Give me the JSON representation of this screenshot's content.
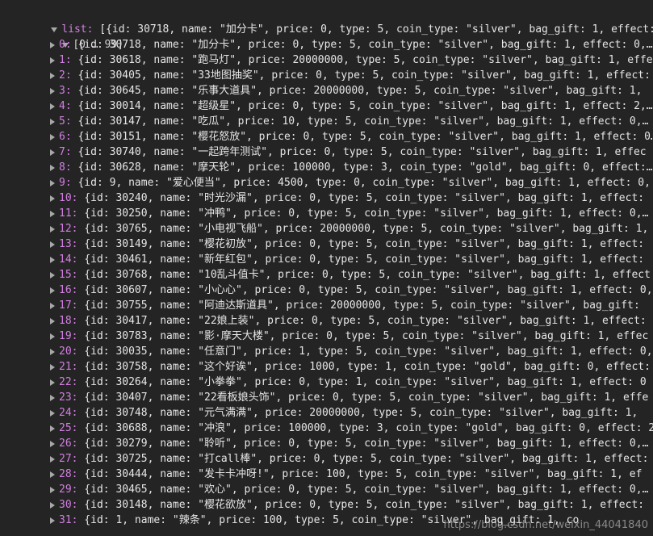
{
  "console": {
    "list_key": "list:",
    "list_preview": "[{id: 30718, name: \"加分卡\", price: 0, type: 5, coin_type: \"silver\", bag_gift: 1, effect: 0,…",
    "range_label": "[0 … 99]",
    "rows": [
      {
        "index": "0:",
        "text": "{id: 30718, name: \"加分卡\", price: 0, type: 5, coin_type: \"silver\", bag_gift: 1, effect: 0,…"
      },
      {
        "index": "1:",
        "text": "{id: 30618, name: \"跑马灯\", price: 20000000, type: 5, coin_type: \"silver\", bag_gift: 1, effe"
      },
      {
        "index": "2:",
        "text": "{id: 30405, name: \"33地图抽奖\", price: 0, type: 5, coin_type: \"silver\", bag_gift: 1, effect:"
      },
      {
        "index": "3:",
        "text": "{id: 30645, name: \"乐事大道具\", price: 20000000, type: 5, coin_type: \"silver\", bag_gift: 1,"
      },
      {
        "index": "4:",
        "text": "{id: 30014, name: \"超级星\", price: 0, type: 5, coin_type: \"silver\", bag_gift: 1, effect: 2,…"
      },
      {
        "index": "5:",
        "text": "{id: 30147, name: \"吃瓜\", price: 10, type: 5, coin_type: \"silver\", bag_gift: 1, effect: 0,…"
      },
      {
        "index": "6:",
        "text": "{id: 30151, name: \"樱花怒放\", price: 0, type: 5, coin_type: \"silver\", bag_gift: 1, effect: 0…"
      },
      {
        "index": "7:",
        "text": "{id: 30740, name: \"一起跨年测试\", price: 0, type: 5, coin_type: \"silver\", bag_gift: 1, effec"
      },
      {
        "index": "8:",
        "text": "{id: 30628, name: \"摩天轮\", price: 100000, type: 3, coin_type: \"gold\", bag_gift: 0, effect:…"
      },
      {
        "index": "9:",
        "text": "{id: 9, name: \"爱心便当\", price: 4500, type: 0, coin_type: \"silver\", bag_gift: 1, effect: 0,"
      },
      {
        "index": "10:",
        "text": "{id: 30240, name: \"时光沙漏\", price: 0, type: 5, coin_type: \"silver\", bag_gift: 1, effect:"
      },
      {
        "index": "11:",
        "text": "{id: 30250, name: \"冲鸭\", price: 0, type: 5, coin_type: \"silver\", bag_gift: 1, effect: 0,…"
      },
      {
        "index": "12:",
        "text": "{id: 30765, name: \"小电视飞船\", price: 20000000, type: 5, coin_type: \"silver\", bag_gift: 1,"
      },
      {
        "index": "13:",
        "text": "{id: 30149, name: \"樱花初放\", price: 0, type: 5, coin_type: \"silver\", bag_gift: 1, effect:"
      },
      {
        "index": "14:",
        "text": "{id: 30461, name: \"新年红包\", price: 0, type: 5, coin_type: \"silver\", bag_gift: 1, effect:"
      },
      {
        "index": "15:",
        "text": "{id: 30768, name: \"10乱斗值卡\", price: 0, type: 5, coin_type: \"silver\", bag_gift: 1, effect"
      },
      {
        "index": "16:",
        "text": "{id: 30607, name: \"小心心\", price: 0, type: 5, coin_type: \"silver\", bag_gift: 1, effect: 0,"
      },
      {
        "index": "17:",
        "text": "{id: 30755, name: \"阿迪达斯道具\", price: 20000000, type: 5, coin_type: \"silver\", bag_gift:"
      },
      {
        "index": "18:",
        "text": "{id: 30417, name: \"22娘上装\", price: 0, type: 5, coin_type: \"silver\", bag_gift: 1, effect:"
      },
      {
        "index": "19:",
        "text": "{id: 30783, name: \"影·摩天大楼\", price: 0, type: 5, coin_type: \"silver\", bag_gift: 1, effec"
      },
      {
        "index": "20:",
        "text": "{id: 30035, name: \"任意门\", price: 1, type: 5, coin_type: \"silver\", bag_gift: 1, effect: 0,"
      },
      {
        "index": "21:",
        "text": "{id: 30758, name: \"这个好诶\", price: 1000, type: 1, coin_type: \"gold\", bag_gift: 0, effect:"
      },
      {
        "index": "22:",
        "text": "{id: 30264, name: \"小拳拳\", price: 0, type: 1, coin_type: \"silver\", bag_gift: 1, effect: 0"
      },
      {
        "index": "23:",
        "text": "{id: 30407, name: \"22看板娘头饰\", price: 0, type: 5, coin_type: \"silver\", bag_gift: 1, effe"
      },
      {
        "index": "24:",
        "text": "{id: 30748, name: \"元气满满\", price: 20000000, type: 5, coin_type: \"silver\", bag_gift: 1,"
      },
      {
        "index": "25:",
        "text": "{id: 30688, name: \"冲浪\", price: 100000, type: 3, coin_type: \"gold\", bag_gift: 0, effect: 2"
      },
      {
        "index": "26:",
        "text": "{id: 30279, name: \"聆听\", price: 0, type: 5, coin_type: \"silver\", bag_gift: 1, effect: 0,…"
      },
      {
        "index": "27:",
        "text": "{id: 30725, name: \"打call棒\", price: 0, type: 5, coin_type: \"silver\", bag_gift: 1, effect:"
      },
      {
        "index": "28:",
        "text": "{id: 30444, name: \"发卡卡冲呀!\", price: 100, type: 5, coin_type: \"silver\", bag_gift: 1, ef"
      },
      {
        "index": "29:",
        "text": "{id: 30465, name: \"欢心\", price: 0, type: 5, coin_type: \"silver\", bag_gift: 1, effect: 0,…"
      },
      {
        "index": "30:",
        "text": "{id: 30148, name: \"樱花欲放\", price: 0, type: 5, coin_type: \"silver\", bag_gift: 1, effect:"
      },
      {
        "index": "31:",
        "text": "{id: 1, name: \"辣条\", price: 100, type: 5, coin_type: \"silver\", bag_gift: 1, co"
      }
    ]
  },
  "watermark": "https://blog.csdn.net/weixin_44041840"
}
